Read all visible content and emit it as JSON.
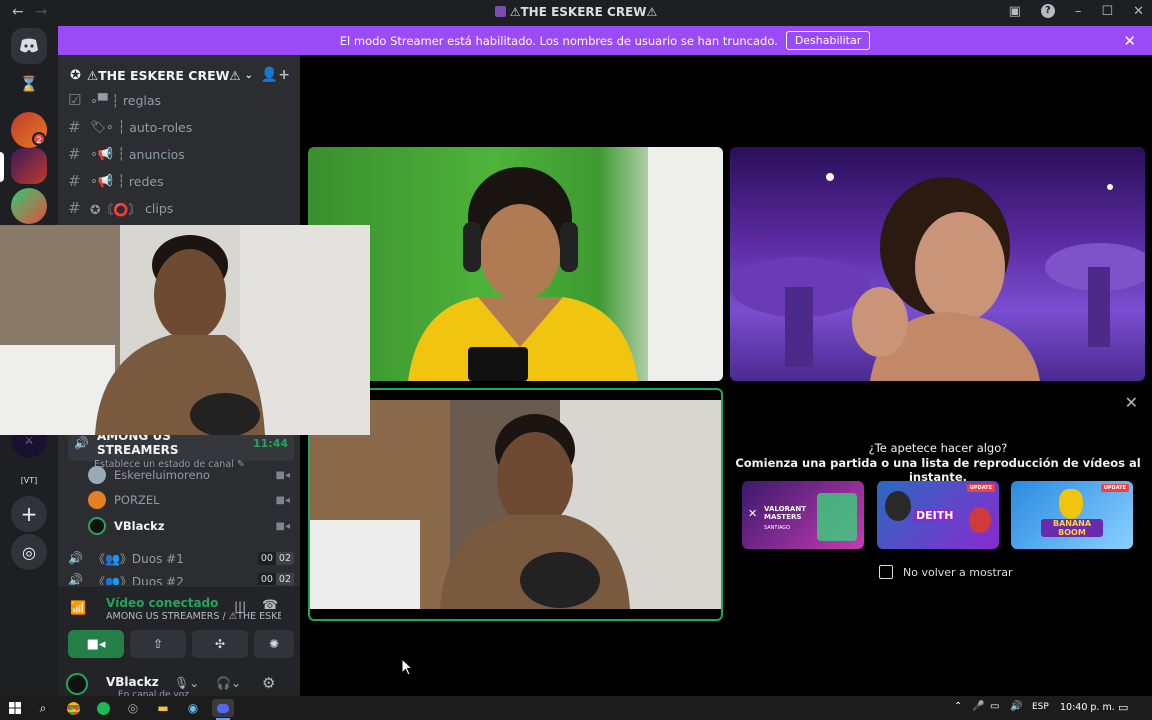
{
  "window": {
    "title": "⚠THE ESKERE CREW⚠",
    "back": "←",
    "forward": "→"
  },
  "banner": {
    "text": "El modo Streamer está habilitado. Los nombres de usuario se han truncado.",
    "button": "Deshabilitar",
    "close": "✕"
  },
  "server": {
    "name": "⚠THE ESKERE CREW⚠",
    "channels": [
      {
        "name": "reglas",
        "prefix": "∘▀ ┆"
      },
      {
        "name": "auto-roles",
        "prefix": "🏷∘ ┆"
      },
      {
        "name": "anuncios",
        "prefix": "∘📢 ┆"
      },
      {
        "name": "redes",
        "prefix": "∘📢 ┆"
      },
      {
        "name": "clips",
        "prefix": "✪〘⭕〙"
      }
    ],
    "guild_badge": "2"
  },
  "voice_channel": {
    "name": "AMONG US STREAMERS",
    "time": "11:44",
    "status_placeholder": "Establece un estado de canal",
    "members": [
      "Eskereluimoreno",
      "PORZEL",
      "VBlackz"
    ],
    "duos": [
      {
        "name": "《👥》Duos #1",
        "count_a": "00",
        "count_b": "02"
      },
      {
        "name": "《👥》Duos #2",
        "count_a": "00",
        "count_b": "02"
      }
    ]
  },
  "voice_panel": {
    "status": "Vídeo conectado",
    "location": "AMONG US STREAMERS / ⚠THE ESKE..."
  },
  "user": {
    "name": "VBlackz",
    "status": "En canal de voz"
  },
  "activity": {
    "question": "¿Te apetece hacer algo?",
    "prompt": "Comienza una partida o una lista de reproducción de vídeos al instante.",
    "cards": [
      {
        "title": "VALORANT MASTERS",
        "subtitle": "SANTIAGO",
        "badge": ""
      },
      {
        "title": "DEITH",
        "subtitle": "",
        "badge": "UPDATE"
      },
      {
        "title": "BANANA BOOM",
        "subtitle": "",
        "badge": "UPDATE"
      }
    ],
    "dont_show": "No volver a mostrar"
  },
  "taskbar": {
    "lang": "ESP",
    "time": "10:40 p. m."
  },
  "colors": {
    "banner": "#9b4bf5",
    "green": "#23a55a",
    "sidebar": "#2b2d31"
  }
}
